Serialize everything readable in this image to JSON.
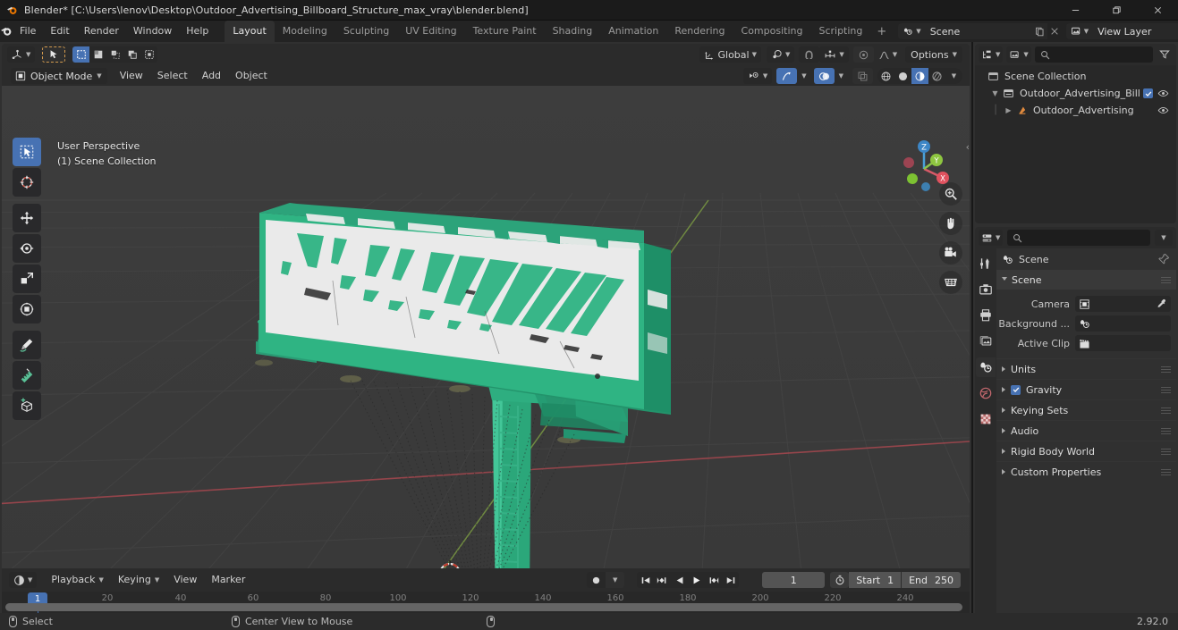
{
  "window": {
    "title": "Blender* [C:\\Users\\lenov\\Desktop\\Outdoor_Advertising_Billboard_Structure_max_vray\\blender.blend]",
    "minimize": "—",
    "maximize": "❐",
    "close": "✕"
  },
  "topbar": {
    "menus": [
      "File",
      "Edit",
      "Render",
      "Window",
      "Help"
    ],
    "workspaces": [
      {
        "label": "Layout",
        "active": true
      },
      {
        "label": "Modeling",
        "active": false
      },
      {
        "label": "Sculpting",
        "active": false
      },
      {
        "label": "UV Editing",
        "active": false
      },
      {
        "label": "Texture Paint",
        "active": false
      },
      {
        "label": "Shading",
        "active": false
      },
      {
        "label": "Animation",
        "active": false
      },
      {
        "label": "Rendering",
        "active": false
      },
      {
        "label": "Compositing",
        "active": false
      },
      {
        "label": "Scripting",
        "active": false
      }
    ],
    "add_workspace": "+",
    "scene_name": "Scene",
    "view_layer_name": "View Layer",
    "new_copy_icon": "duplicate-icon",
    "unlink_icon": "x-icon"
  },
  "viewport_header": {
    "editor_type": "editor-type-3d-viewport",
    "select_modes": [
      "tweak",
      "select-box",
      "select-circle",
      "select-lasso"
    ],
    "transform_orientation": "Global",
    "pivot_icon": "pivot-point-icon",
    "snap_icon": "magnet-icon",
    "snap_to": "snap-increment-icon",
    "proportional_icon": "proportional-editing-icon",
    "falloff_icon": "smooth-falloff-icon",
    "options_label": "Options",
    "mode": "Object Mode",
    "menus": [
      "View",
      "Select",
      "Add",
      "Object"
    ],
    "visibility_icon": "object-type-visibility-icon",
    "gizmo_icon": "gizmo-icon",
    "overlays_icon": "overlays-icon",
    "xray_icon": "xray-toggle-icon",
    "shading_modes": [
      "wireframe",
      "solid",
      "material-preview",
      "rendered"
    ],
    "shading_active_index": 2
  },
  "viewport": {
    "overlay_line1": "User Perspective",
    "overlay_line2": "(1) Scene Collection",
    "tools": [
      "tweak-tool",
      "cursor-tool",
      "move-tool",
      "rotate-tool",
      "scale-tool",
      "transform-tool",
      "annotate-tool",
      "measure-tool",
      "add-cube-tool"
    ],
    "gizmo_axes": [
      "Z",
      "Y",
      "X"
    ],
    "nav_buttons": [
      "zoom-icon",
      "pan-hand-icon",
      "camera-view-icon",
      "toggle-orthographic-icon"
    ],
    "sidebar_toggle": "‹"
  },
  "timeline": {
    "editor_type": "editor-type-timeline",
    "menus": [
      "Playback",
      "Keying",
      "View",
      "Marker"
    ],
    "record_icon": "auto-keying-icon",
    "transport": [
      "jump-to-start",
      "jump-to-prev-keyframe",
      "play-reverse",
      "play",
      "jump-to-next-keyframe",
      "jump-to-end"
    ],
    "current_frame": "1",
    "timer_icon": "use-preview-range-icon",
    "start_label": "Start",
    "start_value": "1",
    "end_label": "End",
    "end_value": "250",
    "ticks": [
      20,
      40,
      60,
      80,
      100,
      120,
      140,
      160,
      180,
      200,
      220,
      240
    ],
    "playhead_frame": "1"
  },
  "outliner": {
    "display_mode_icon": "outliner-display-mode-icon",
    "filter_id_icon": "filter-id-icon",
    "search_placeholder": "",
    "search_icon": "search-icon",
    "filter_icon": "funnel-filter-icon",
    "rows": [
      {
        "label": "Scene Collection",
        "indent": 0,
        "icon": "scene-collection-icon",
        "disclosure": "",
        "checkbox": false,
        "eye": false
      },
      {
        "label": "Outdoor_Advertising_Bill",
        "indent": 1,
        "icon": "collection-icon",
        "disclosure": "down",
        "checkbox": true,
        "eye": true
      },
      {
        "label": "Outdoor_Advertising",
        "indent": 2,
        "icon": "mesh-object-icon",
        "disclosure": "right",
        "checkbox": false,
        "eye": true
      }
    ]
  },
  "properties": {
    "editor_type_icon": "editor-type-properties-icon",
    "search_placeholder": "",
    "search_icon": "search-icon",
    "options_caret": "chevron-down-icon",
    "tabs": [
      {
        "name": "tool-tab",
        "active": false
      },
      {
        "name": "render-tab",
        "active": false
      },
      {
        "name": "output-tab",
        "active": false
      },
      {
        "name": "view-layer-tab",
        "active": false
      },
      {
        "name": "scene-tab",
        "active": true
      },
      {
        "name": "world-tab",
        "active": false
      },
      {
        "name": "texture-tab",
        "active": false
      }
    ],
    "breadcrumb": "Scene",
    "pin_icon": "pin-icon",
    "panel_title": "Scene",
    "fields": [
      {
        "label": "Camera",
        "value": "",
        "icon": "camera-data-icon",
        "action": "eyedropper-icon"
      },
      {
        "label": "Background ...",
        "value": "",
        "icon": "scene-data-icon",
        "action": ""
      },
      {
        "label": "Active Clip",
        "value": "",
        "icon": "movie-clip-icon",
        "action": ""
      }
    ],
    "sections": [
      {
        "label": "Units",
        "checkbox": false
      },
      {
        "label": "Gravity",
        "checkbox": true
      },
      {
        "label": "Keying Sets",
        "checkbox": false
      },
      {
        "label": "Audio",
        "checkbox": false
      },
      {
        "label": "Rigid Body World",
        "checkbox": false
      },
      {
        "label": "Custom Properties",
        "checkbox": false
      }
    ]
  },
  "statusbar": {
    "items": [
      {
        "icon": "mouse-left-icon",
        "label": "Select"
      },
      {
        "icon": "mouse-middle-icon",
        "label": "Center View to Mouse"
      },
      {
        "icon": "mouse-right-icon",
        "label": ""
      }
    ],
    "version": "2.92.0"
  },
  "colors": {
    "accent_blue": "#4772b3",
    "model_green": "#2fb483",
    "model_white": "#e9e9e9",
    "axis_x_red": "#a14b55",
    "axis_y_green": "#7fa34b",
    "viewport_bg": "#3b3b3b"
  }
}
